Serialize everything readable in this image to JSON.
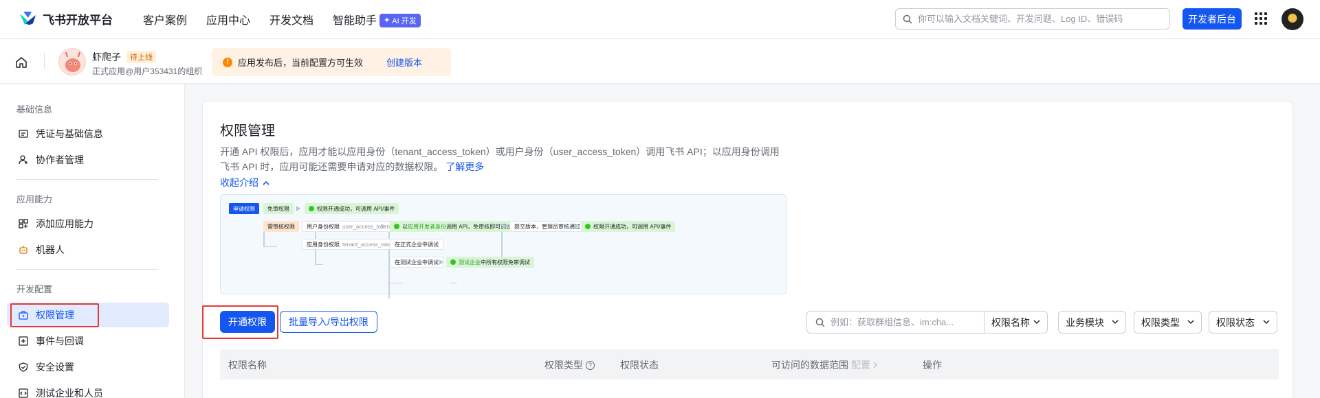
{
  "topnav": {
    "logo_text": "飞书开放平台",
    "links": [
      "客户案例",
      "应用中心",
      "开发文档",
      "智能助手"
    ],
    "ai_badge": "AI 开发",
    "search_placeholder": "你可以输入文档关键词、开发问题、Log ID、错误码",
    "dev_button": "开发者后台"
  },
  "subheader": {
    "app_name": "虾爬子",
    "app_status": "待上线",
    "app_org": "正式应用@用户353431的组织",
    "notice_text": "应用发布后，当前配置方可生效",
    "notice_link": "创建版本"
  },
  "sidebar": {
    "groups": [
      {
        "title": "基础信息",
        "items": [
          "凭证与基础信息",
          "协作者管理"
        ]
      },
      {
        "title": "应用能力",
        "items": [
          "添加应用能力",
          "机器人"
        ]
      },
      {
        "title": "开发配置",
        "items": [
          "权限管理",
          "事件与回调",
          "安全设置",
          "测试企业和人员"
        ]
      }
    ],
    "active_item": "权限管理"
  },
  "main": {
    "title": "权限管理",
    "description": "开通 API 权限后，应用才能以应用身份（tenant_access_token）或用户身份（user_access_token）调用飞书 API；以应用身份调用飞书 API 时，应用可能还需要申请对应的数据权限。",
    "learn_more": "了解更多",
    "collapse_label": "收起介绍",
    "flow": {
      "apply": "申请权限",
      "no_review": "免审权限",
      "ok_callable": "权限开通成功，可调用 API/事件",
      "needs_review": "需审核权限",
      "user_perm": "用户身份权限",
      "user_token": "user_access_token 调用",
      "dev_prefix": "以",
      "dev_hl": "应用开发者身份",
      "dev_suffix": "调用 API，免审核即可调试",
      "submit": "提交版本，管理员审核通过",
      "ok_callable_2": "权限开通成功，可调用 API/事件",
      "app_perm": "应用身份权限",
      "tenant_token": "tenant_access_token 调用",
      "debug_formal": "在正式企业中调试",
      "debug_test": "在测试企业中调试",
      "test_hl": "测试企业",
      "test_suffix": "中所有权限免审调试"
    },
    "buttons": {
      "open_perm": "开通权限",
      "batch": "批量导入/导出权限"
    },
    "filters": {
      "search_placeholder": "例如：获取群组信息、im:cha...",
      "field": "权限名称",
      "module": "业务模块",
      "type": "权限类型",
      "status": "权限状态"
    },
    "table": {
      "columns": [
        "权限名称",
        "权限类型",
        "权限状态",
        "可访问的数据范围",
        "操作"
      ],
      "scope_config": "配置"
    }
  },
  "colors": {
    "accent": "#1456f0",
    "highlight_box": "#e53935"
  }
}
